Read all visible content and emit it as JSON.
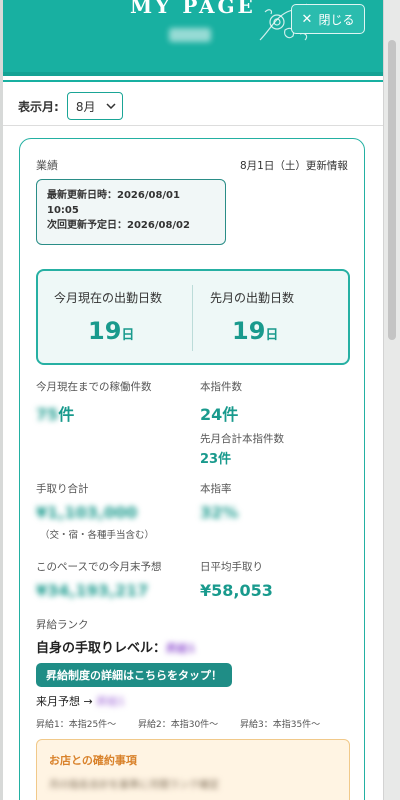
{
  "header": {
    "title": "MY PAGE",
    "close_label": "閉じる"
  },
  "month_filter": {
    "label": "表示月:",
    "selected": "8月"
  },
  "performance": {
    "section_label": "業績",
    "update_info": "8月1日（土）更新情報",
    "last_update_line1": "最新更新日時：2026/08/01",
    "last_update_line2": "10:05",
    "next_update": "次回更新予定日：2026/08/02",
    "attendance": {
      "current_label": "今月現在の出勤日数",
      "current_value": "19",
      "current_unit": "日",
      "prev_label": "先月の出勤日数",
      "prev_value": "19",
      "prev_unit": "日"
    },
    "stats": {
      "work_count_label": "今月現在までの稼働件数",
      "work_count_value": "75",
      "work_count_unit": "件",
      "nominations_label": "本指件数",
      "nominations_value": "24件",
      "prev_total_label": "先月合計本指件数",
      "prev_total_value": "23件",
      "takehome_label": "手取り合計",
      "takehome_value": "¥1,103,000",
      "takehome_note": "（交・宿・各種手当含む）",
      "nomination_rate_label": "本指率",
      "nomination_rate_value": "32%",
      "forecast_label": "このペースでの今月末予想",
      "forecast_value": "¥34,193,217",
      "daily_avg_label": "日平均手取り",
      "daily_avg_value": "¥58,053"
    },
    "raise": {
      "label": "昇給ランク",
      "own_level_label": "自身の手取りレベル：",
      "own_level_value": "昇給1",
      "details_button": "昇給制度の詳細はこちらをタップ！",
      "next_month_label": "来月予想 →",
      "next_month_value": "昇給1",
      "tiers": [
        "昇給1：本指25件〜",
        "昇給2：本指30件〜",
        "昇給3：本指35件〜"
      ]
    },
    "notice": {
      "title": "お店との確約事項",
      "body": "月の指名合計を基準に月間ランク確定"
    }
  },
  "colors": {
    "brand_teal": "#18b0a1",
    "value_teal": "#199a8d",
    "button_teal": "#1f8d86",
    "notice_bg": "#fff4e3",
    "notice_title": "#d9822b"
  }
}
